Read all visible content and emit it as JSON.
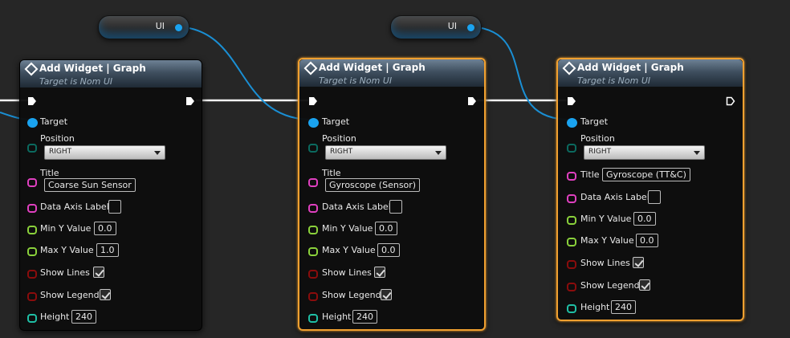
{
  "variables": [
    {
      "label": "UI"
    },
    {
      "label": "UI"
    }
  ],
  "nodes": [
    {
      "title": "Add Widget | Graph",
      "subtitle": "Target is Nom UI",
      "selected": false,
      "pins": {
        "target": "Target",
        "position": "Position",
        "position_value": "RIGHT",
        "title": "Title",
        "title_value": "Coarse Sun Sensor",
        "data_axis_label": "Data Axis Label",
        "min_y": "Min Y Value",
        "min_y_value": "0.0",
        "max_y": "Max Y Value",
        "max_y_value": "1.0",
        "show_lines": "Show Lines",
        "show_lines_checked": true,
        "show_legend": "Show Legend",
        "show_legend_checked": true,
        "height": "Height",
        "height_value": "240"
      }
    },
    {
      "title": "Add Widget | Graph",
      "subtitle": "Target is Nom UI",
      "selected": true,
      "pins": {
        "target": "Target",
        "position": "Position",
        "position_value": "RIGHT",
        "title": "Title",
        "title_value": "Gyroscope (Sensor)",
        "data_axis_label": "Data Axis Label",
        "min_y": "Min Y Value",
        "min_y_value": "0.0",
        "max_y": "Max Y Value",
        "max_y_value": "0.0",
        "show_lines": "Show Lines",
        "show_lines_checked": true,
        "show_legend": "Show Legend",
        "show_legend_checked": true,
        "height": "Height",
        "height_value": "240"
      }
    },
    {
      "title": "Add Widget | Graph",
      "subtitle": "Target is Nom UI",
      "selected": true,
      "pins": {
        "target": "Target",
        "position": "Position",
        "position_value": "RIGHT",
        "title": "Title",
        "title_value": "Gyroscope (TT&C)",
        "data_axis_label": "Data Axis Label",
        "min_y": "Min Y Value",
        "min_y_value": "0.0",
        "max_y": "Max Y Value",
        "max_y_value": "0.0",
        "show_lines": "Show Lines",
        "show_lines_checked": true,
        "show_legend": "Show Legend",
        "show_legend_checked": true,
        "height": "Height",
        "height_value": "240"
      }
    }
  ],
  "colors": {
    "background": "#262626",
    "selection": "#f0a030",
    "object_pin": "#1aa3f0",
    "text_pin": "#e040c0",
    "float_pin": "#8ad13b",
    "bool_pin": "#8a0c0c",
    "int_pin": "#1fbfa5",
    "enum_pin": "#0b6a5f",
    "exec_wire": "#ffffff"
  }
}
